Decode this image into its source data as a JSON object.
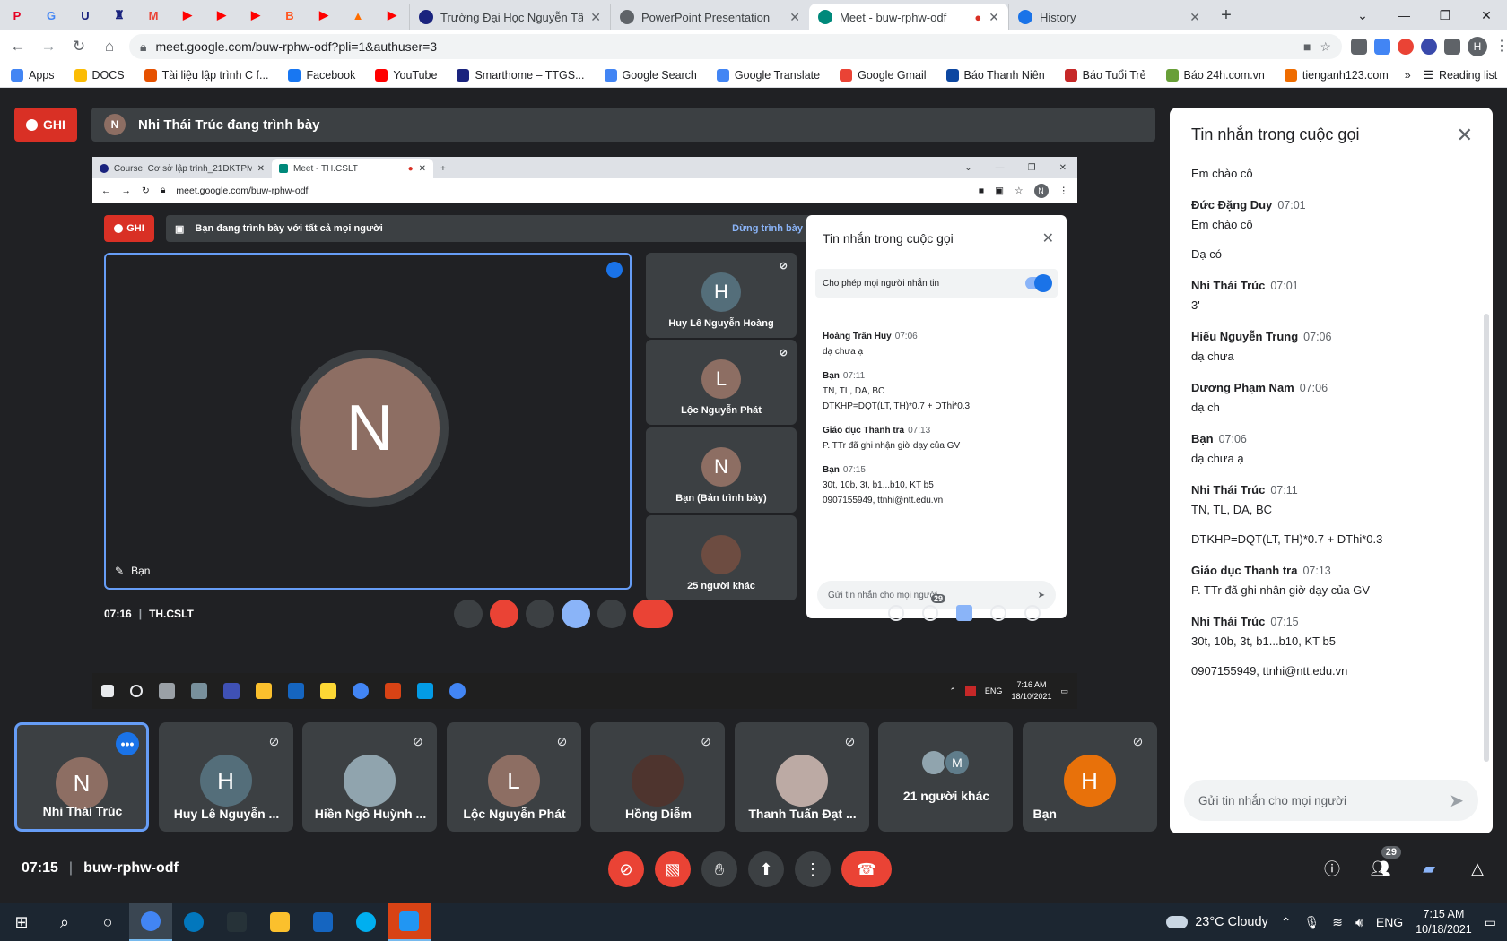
{
  "browser": {
    "pinned_tabs": [
      {
        "icon": "pinterest-icon",
        "color": "#e60023",
        "glyph": "P"
      },
      {
        "icon": "google-icon",
        "color": "#4285f4",
        "glyph": "G"
      },
      {
        "icon": "shield-icon",
        "color": "#1a237e",
        "glyph": "U"
      },
      {
        "icon": "university-icon",
        "color": "#1a237e",
        "glyph": "♜"
      },
      {
        "icon": "gmail-icon",
        "color": "#ea4335",
        "glyph": "M"
      },
      {
        "icon": "youtube-icon",
        "color": "#ff0000",
        "glyph": "▶"
      },
      {
        "icon": "youtube-icon",
        "color": "#ff0000",
        "glyph": "▶"
      },
      {
        "icon": "youtube-icon",
        "color": "#ff0000",
        "glyph": "▶"
      },
      {
        "icon": "blogger-icon",
        "color": "#ff5722",
        "glyph": "B"
      },
      {
        "icon": "youtube-icon",
        "color": "#ff0000",
        "glyph": "▶"
      },
      {
        "icon": "fire-icon",
        "color": "#ff6d00",
        "glyph": "▲"
      },
      {
        "icon": "youtube-icon",
        "color": "#ff0000",
        "glyph": "▶"
      }
    ],
    "tabs": [
      {
        "title": "Trường Đại Học Nguyễn Tất Thà",
        "color": "#1a237e",
        "active": false
      },
      {
        "title": "PowerPoint Presentation",
        "color": "#5f6368",
        "active": false
      },
      {
        "title": "Meet - buw-rphw-odf",
        "color": "#00897b",
        "active": true
      },
      {
        "title": "History",
        "color": "#1a73e8",
        "active": false
      }
    ],
    "url": "meet.google.com/buw-rphw-odf?pli=1&authuser=3",
    "profile_initial": "H",
    "bookmarks": [
      {
        "label": "Apps",
        "color": "#4285f4"
      },
      {
        "label": "DOCS",
        "color": "#fbbc04"
      },
      {
        "label": "Tài liệu lập trình C f...",
        "color": "#e65100"
      },
      {
        "label": "Facebook",
        "color": "#1877f2"
      },
      {
        "label": "YouTube",
        "color": "#ff0000"
      },
      {
        "label": "Smarthome – TTGS...",
        "color": "#1a237e"
      },
      {
        "label": "Google Search",
        "color": "#4285f4"
      },
      {
        "label": "Google Translate",
        "color": "#4285f4"
      },
      {
        "label": "Google Gmail",
        "color": "#ea4335"
      },
      {
        "label": "Báo Thanh Niên",
        "color": "#0d47a1"
      },
      {
        "label": "Báo Tuổi Trẻ",
        "color": "#c62828"
      },
      {
        "label": "Báo 24h.com.vn",
        "color": "#689f38"
      },
      {
        "label": "tienganh123.com",
        "color": "#ef6c00"
      }
    ],
    "more_glyph": "»",
    "reading_list": "Reading list"
  },
  "meet": {
    "rec_label": "GHI",
    "presenting_initial": "N",
    "presenting_text": "Nhi Thái Trúc đang trình bày",
    "shared": {
      "tab1": "Course: Cơ sở lập trình_21DKTPM",
      "tab2": "Meet - TH.CSLT",
      "url": "meet.google.com/buw-rphw-odf",
      "profile_initial": "N",
      "rec_label": "GHI",
      "presenting_text": "Bạn đang trình bày với tất cả mọi người",
      "stop_label": "Dừng trình bày",
      "main_initial": "N",
      "main_name": "Bạn",
      "tiles": [
        {
          "initial": "H",
          "name": "Huy Lê Nguyễn Hoàng",
          "color": "#546e7a"
        },
        {
          "initial": "L",
          "name": "Lộc Nguyễn Phát",
          "color": "#8d6e63"
        },
        {
          "initial": "N",
          "name": "Bạn (Bản trình bày)",
          "color": "#8d6e63"
        },
        {
          "initial": "",
          "name": "25 người khác",
          "color": "#6d4c41"
        }
      ],
      "chat_title": "Tin nhắn trong cuộc gọi",
      "allow_label": "Cho phép mọi người nhắn tin",
      "messages": [
        {
          "who": "Hoàng Trần Huy",
          "time": "07:06",
          "lines": [
            "dạ chưa ạ"
          ]
        },
        {
          "who": "Bạn",
          "time": "07:11",
          "lines": [
            "TN, TL, DA, BC",
            "DTKHP=DQT(LT, TH)*0.7 + DThi*0.3"
          ]
        },
        {
          "who": "Giáo dục Thanh tra",
          "time": "07:13",
          "lines": [
            "P. TTr đã ghi nhận giờ dạy của GV"
          ]
        },
        {
          "who": "Bạn",
          "time": "07:15",
          "lines": [
            "30t, 10b, 3t, b1...b10, KT b5",
            "0907155949, ttnhi@ntt.edu.vn"
          ]
        }
      ],
      "input_placeholder": "Gửi tin nhắn cho mọi người",
      "time": "07:16",
      "meeting_name": "TH.CSLT",
      "taskbar_time": "7:16 AM",
      "taskbar_date": "18/10/2021",
      "taskbar_lang": "ENG",
      "participant_count": "29"
    },
    "participants": [
      {
        "initial": "N",
        "name": "Nhi Thái Trúc",
        "color": "#8d6e63",
        "active": true,
        "muted": false
      },
      {
        "initial": "H",
        "name": "Huy Lê Nguyễn ...",
        "color": "#546e7a",
        "active": false,
        "muted": true
      },
      {
        "initial": "",
        "name": "Hiền Ngô Huỳnh ...",
        "color": "#90a4ae",
        "active": false,
        "muted": true
      },
      {
        "initial": "L",
        "name": "Lộc Nguyễn Phát",
        "color": "#8d6e63",
        "active": false,
        "muted": true
      },
      {
        "initial": "",
        "name": "Hồng Diễm",
        "color": "#4e342e",
        "active": false,
        "muted": true
      },
      {
        "initial": "",
        "name": "Thanh Tuấn Đạt ...",
        "color": "#bcaaa4",
        "active": false,
        "muted": true
      },
      {
        "initial": "M",
        "name": "21 người khác",
        "color": "#607d8b",
        "active": false,
        "muted": false,
        "stack": true
      },
      {
        "initial": "H",
        "name": "Bạn",
        "color": "#e8710a",
        "active": false,
        "muted": true
      }
    ],
    "time": "07:15",
    "separator": "|",
    "meeting_code": "buw-rphw-odf",
    "participant_count": "29"
  },
  "chat": {
    "title": "Tin nhắn trong cuộc gọi",
    "messages": [
      {
        "who": "",
        "time": "",
        "lines": [
          "Em chào cô"
        ]
      },
      {
        "who": "Đức Đặng Duy",
        "time": "07:01",
        "lines": [
          "Em chào cô",
          "Dạ có"
        ]
      },
      {
        "who": "Nhi Thái Trúc",
        "time": "07:01",
        "lines": [
          "3'"
        ]
      },
      {
        "who": "Hiếu Nguyễn Trung",
        "time": "07:06",
        "lines": [
          "dạ chưa"
        ]
      },
      {
        "who": "Dương Phạm Nam",
        "time": "07:06",
        "lines": [
          "dạ ch"
        ]
      },
      {
        "who": "Bạn",
        "time": "07:06",
        "lines": [
          "dạ chưa ạ"
        ]
      },
      {
        "who": "Nhi Thái Trúc",
        "time": "07:11",
        "lines": [
          "TN, TL, DA, BC",
          "DTKHP=DQT(LT, TH)*0.7 + DThi*0.3"
        ]
      },
      {
        "who": "Giáo dục Thanh tra",
        "time": "07:13",
        "lines": [
          "P. TTr đã ghi nhận giờ dạy của GV"
        ]
      },
      {
        "who": "Nhi Thái Trúc",
        "time": "07:15",
        "lines": [
          "30t, 10b, 3t, b1...b10, KT b5",
          "0907155949, ttnhi@ntt.edu.vn"
        ]
      }
    ],
    "input_placeholder": "Gửi tin nhắn cho mọi người"
  },
  "taskbar": {
    "weather": "23°C Cloudy",
    "lang": "ENG",
    "time": "7:15 AM",
    "date": "10/18/2021"
  }
}
